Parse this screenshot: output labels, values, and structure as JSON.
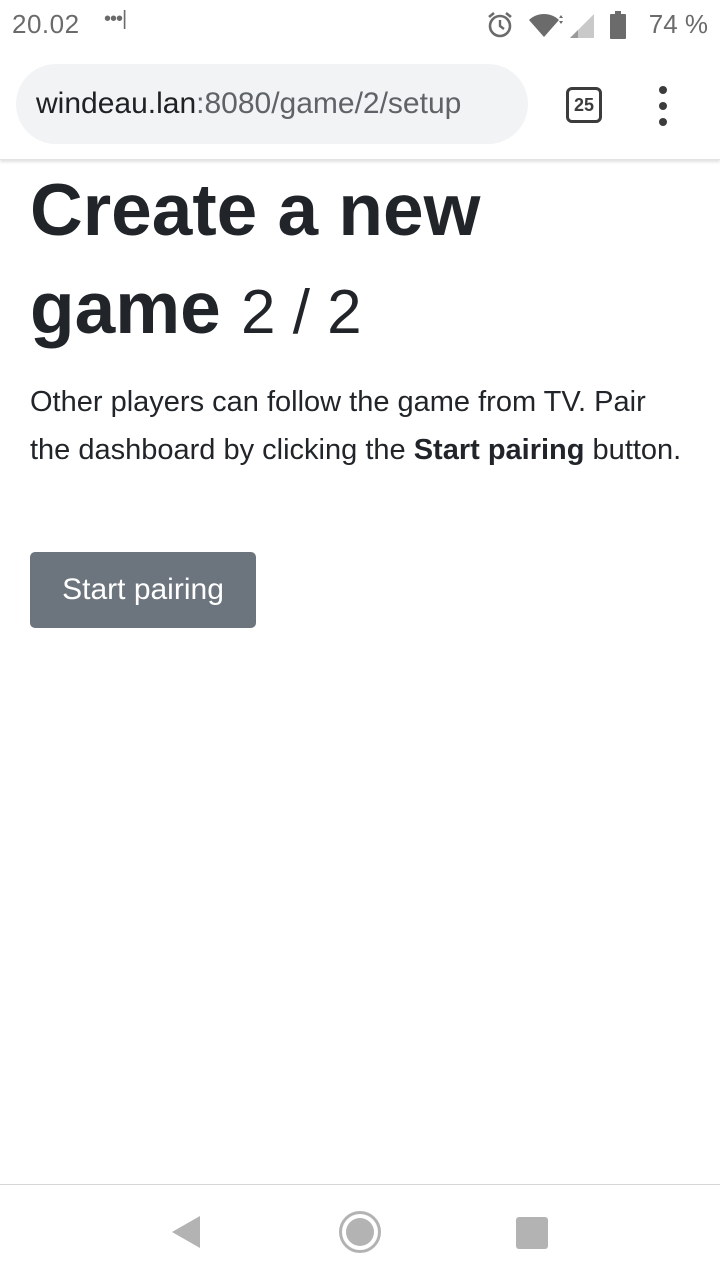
{
  "status_bar": {
    "time": "20.02",
    "notification_dots": "•••|",
    "battery_percent": "74 %",
    "icons": [
      "alarm-icon",
      "wifi-icon",
      "signal-icon",
      "battery-icon"
    ]
  },
  "browser": {
    "url_host": "windeau.lan",
    "url_path": ":8080/game/2/setup",
    "tab_count": "25",
    "menu_icon": "more-vert-icon"
  },
  "page": {
    "title": "Create a new game",
    "step": "2 / 2",
    "description_part1": "Other players can follow the game from TV. Pair the dashboard by clicking the ",
    "description_bold": "Start pairing",
    "description_part2": " button.",
    "start_button_label": "Start pairing"
  },
  "nav_bar": {
    "icons": [
      "back-icon",
      "home-icon",
      "recents-icon"
    ]
  },
  "colors": {
    "button_bg": "#6c757d",
    "text": "#212529",
    "url_bar_bg": "#f1f3f4"
  }
}
